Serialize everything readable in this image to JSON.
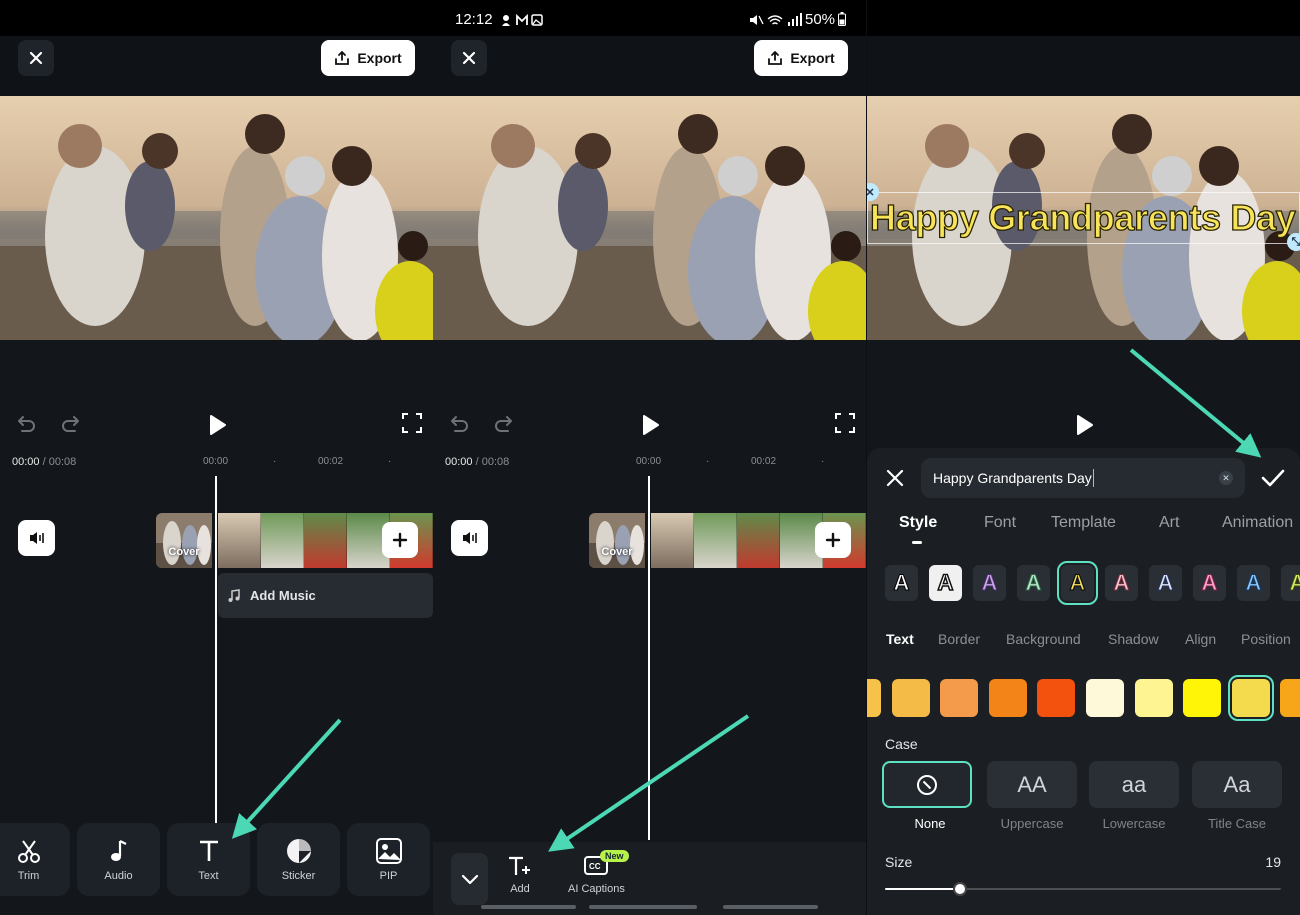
{
  "colors": {
    "accent": "#5EE0C2",
    "arrow": "#4CD8B4",
    "title_fill": "#F7E45A"
  },
  "status_bar": {
    "time": "12:12",
    "battery": "50%"
  },
  "header": {
    "export_label": "Export"
  },
  "timeline": {
    "current_time": "00:00",
    "total_time": "/ 00:08",
    "ruler_ticks": [
      "00:00",
      "00:02"
    ],
    "cover_label": "Cover",
    "add_music_label": "Add Music"
  },
  "toolbar": {
    "tools": [
      {
        "label": "Trim",
        "icon": "scissors-icon"
      },
      {
        "label": "Audio",
        "icon": "music-note-icon"
      },
      {
        "label": "Text",
        "icon": "text-icon"
      },
      {
        "label": "Sticker",
        "icon": "sticker-icon"
      },
      {
        "label": "PIP",
        "icon": "image-icon"
      }
    ]
  },
  "text_submenu": {
    "add_label": "Add",
    "captions_label": "AI Captions",
    "new_badge": "New"
  },
  "overlay": {
    "title_text": "Happy Grandparents Day"
  },
  "editor": {
    "input_value": "Happy Grandparents Day",
    "tabs": [
      "Style",
      "Font",
      "Template",
      "Art",
      "Animation"
    ],
    "active_tab": "Style",
    "style_glyph": "A",
    "subtabs": [
      "Text",
      "Border",
      "Background",
      "Shadow",
      "Align",
      "Position"
    ],
    "active_subtab": "Text",
    "swatches": [
      "#F6C24A",
      "#F4BC47",
      "#F39A4B",
      "#F38518",
      "#F3520E",
      "#FEF9D8",
      "#FEF592",
      "#FEF606",
      "#F4DB4E",
      "#F7A61A"
    ],
    "selected_swatch_index": 8,
    "case_label": "Case",
    "case_options": [
      {
        "glyph": "",
        "label": "None"
      },
      {
        "glyph": "AA",
        "label": "Uppercase"
      },
      {
        "glyph": "aa",
        "label": "Lowercase"
      },
      {
        "glyph": "Aa",
        "label": "Title Case"
      }
    ],
    "selected_case": "None",
    "size_label": "Size",
    "size_value": "19",
    "size_fraction": 0.19
  }
}
